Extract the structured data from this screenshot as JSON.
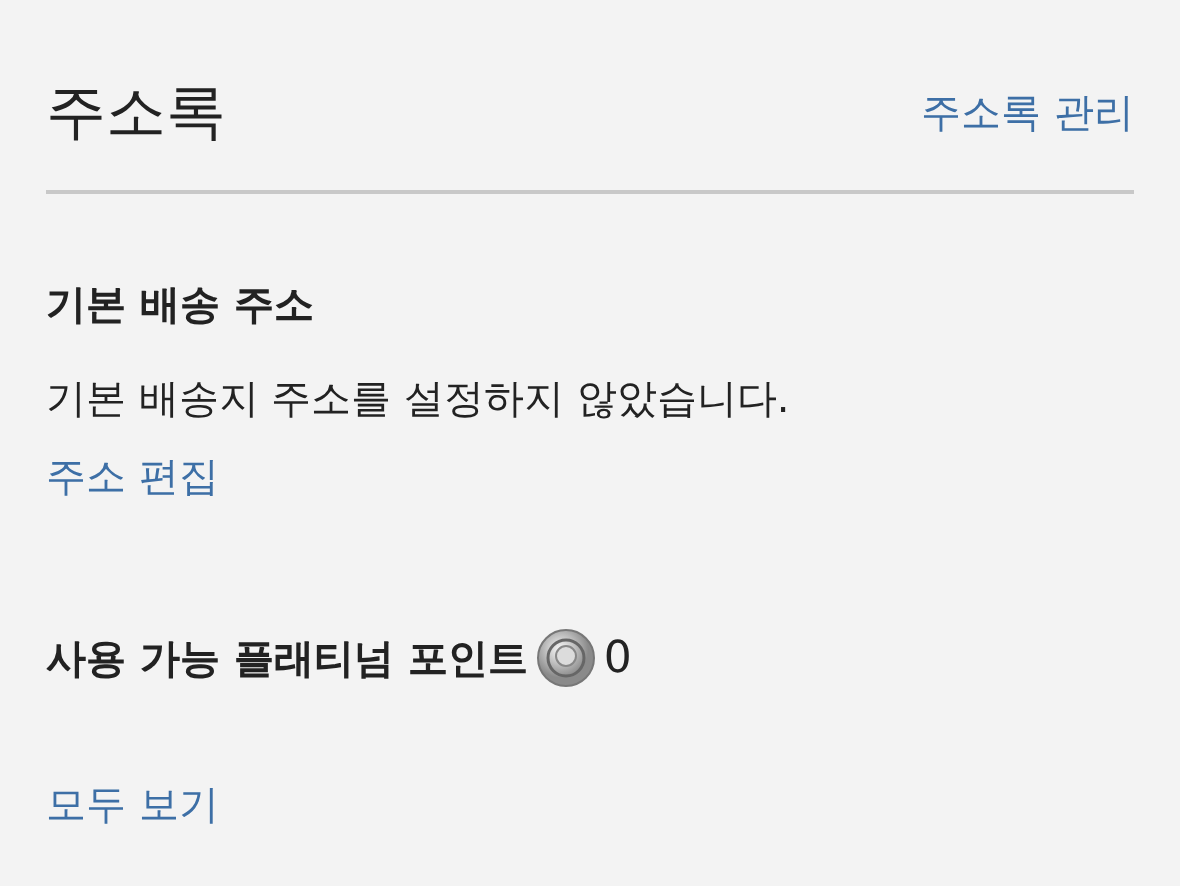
{
  "address_book": {
    "title": "주소록",
    "manage_link": "주소록 관리"
  },
  "default_shipping": {
    "heading": "기본 배송 주소",
    "message": "기본 배송지 주소를 설정하지 않았습니다.",
    "edit_link": "주소 편집"
  },
  "points": {
    "label": "사용 가능 플래티넘 포인트",
    "value": "0",
    "view_all_link": "모두 보기"
  }
}
